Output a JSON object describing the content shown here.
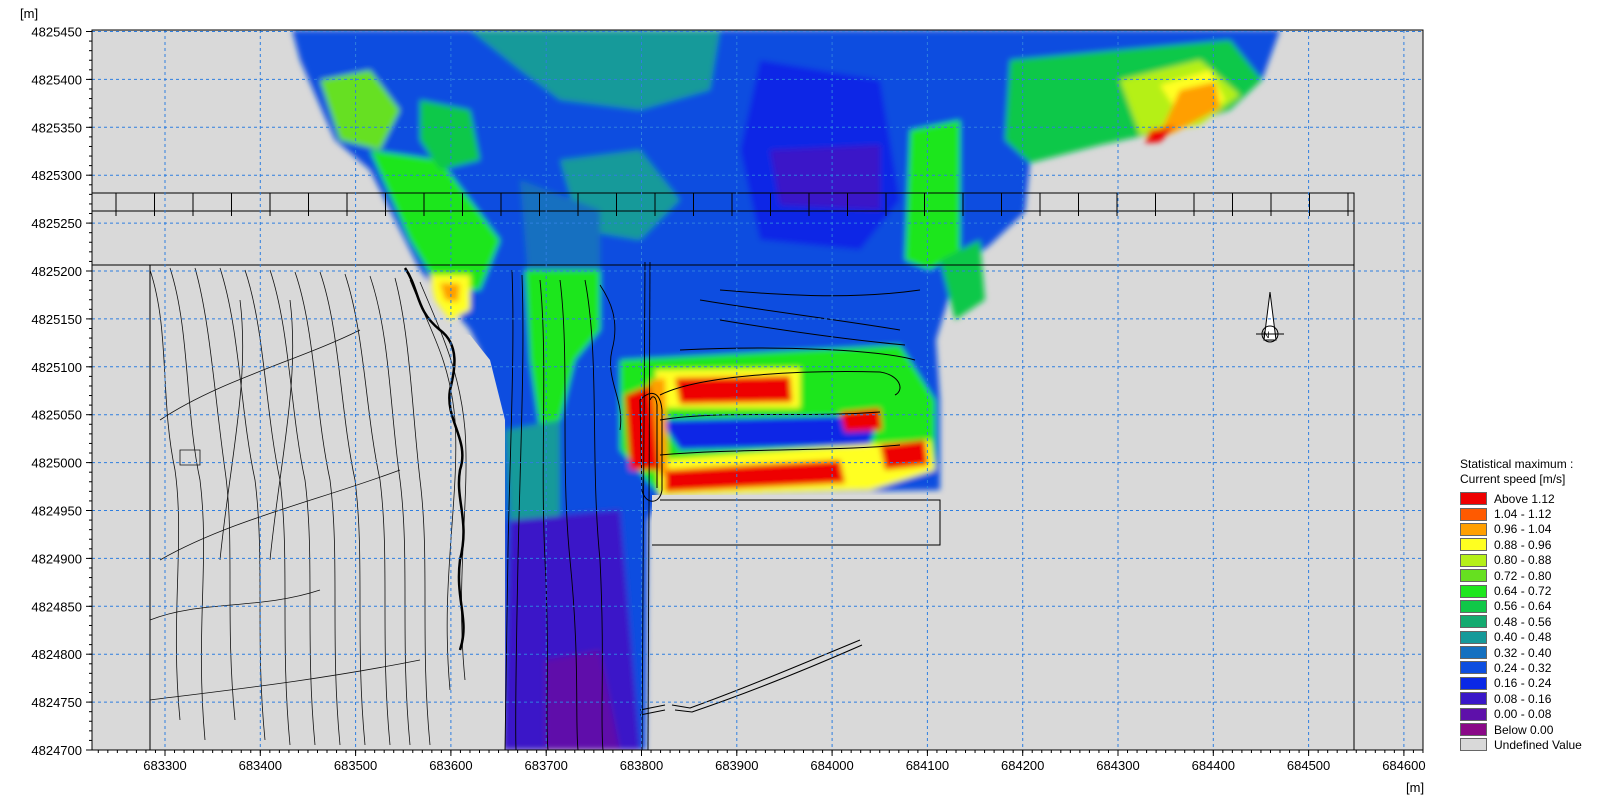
{
  "axis": {
    "x_unit": "[m]",
    "y_unit": "[m]"
  },
  "legend": {
    "title_line1": "Statistical maximum :",
    "title_line2": "Current speed [m/s]"
  },
  "chart_data": {
    "type": "heatmap",
    "title": "",
    "xlabel": "[m]",
    "ylabel": "[m]",
    "xlim": [
      683225,
      683620
    ],
    "ylim": [
      4824700,
      4825460
    ],
    "x_ticks": [
      "683300",
      "683400",
      "683500",
      "683600",
      "683700",
      "683800",
      "683900",
      "684000",
      "684100",
      "684200",
      "684300",
      "684400",
      "684500",
      "684600"
    ],
    "y_ticks": [
      "4824700",
      "4824750",
      "4824800",
      "4824850",
      "4824900",
      "4824950",
      "4825000",
      "4825050",
      "4825100",
      "4825150",
      "4825200",
      "4825250",
      "4825300",
      "4825350",
      "4825400",
      "4825450"
    ],
    "grid": true,
    "legend_position": "bottom-right",
    "legend_entries": [
      {
        "label": "Above 1.12",
        "color": "#ee0000"
      },
      {
        "label": "1.04 - 1.12",
        "color": "#ff5a00"
      },
      {
        "label": "0.96 - 1.04",
        "color": "#ff9f00"
      },
      {
        "label": "0.88 - 0.96",
        "color": "#ffff20"
      },
      {
        "label": "0.80 - 0.88",
        "color": "#b5f018"
      },
      {
        "label": "0.72 - 0.80",
        "color": "#66e020"
      },
      {
        "label": "0.64 - 0.72",
        "color": "#1ee61e"
      },
      {
        "label": "0.56 - 0.64",
        "color": "#10c848"
      },
      {
        "label": "0.48 - 0.56",
        "color": "#14aa70"
      },
      {
        "label": "0.40 - 0.48",
        "color": "#159a9a"
      },
      {
        "label": "0.32 - 0.40",
        "color": "#1470c0"
      },
      {
        "label": "0.24 - 0.32",
        "color": "#0d4ee0"
      },
      {
        "label": "0.16 - 0.24",
        "color": "#0a28e6"
      },
      {
        "label": "0.08 - 0.16",
        "color": "#3a18c8"
      },
      {
        "label": "0.00 - 0.08",
        "color": "#5e10aa"
      },
      {
        "label": "Below  0.00",
        "color": "#8a0a88"
      },
      {
        "label": "Undefined Value",
        "color": "#d9d9d9"
      }
    ]
  }
}
